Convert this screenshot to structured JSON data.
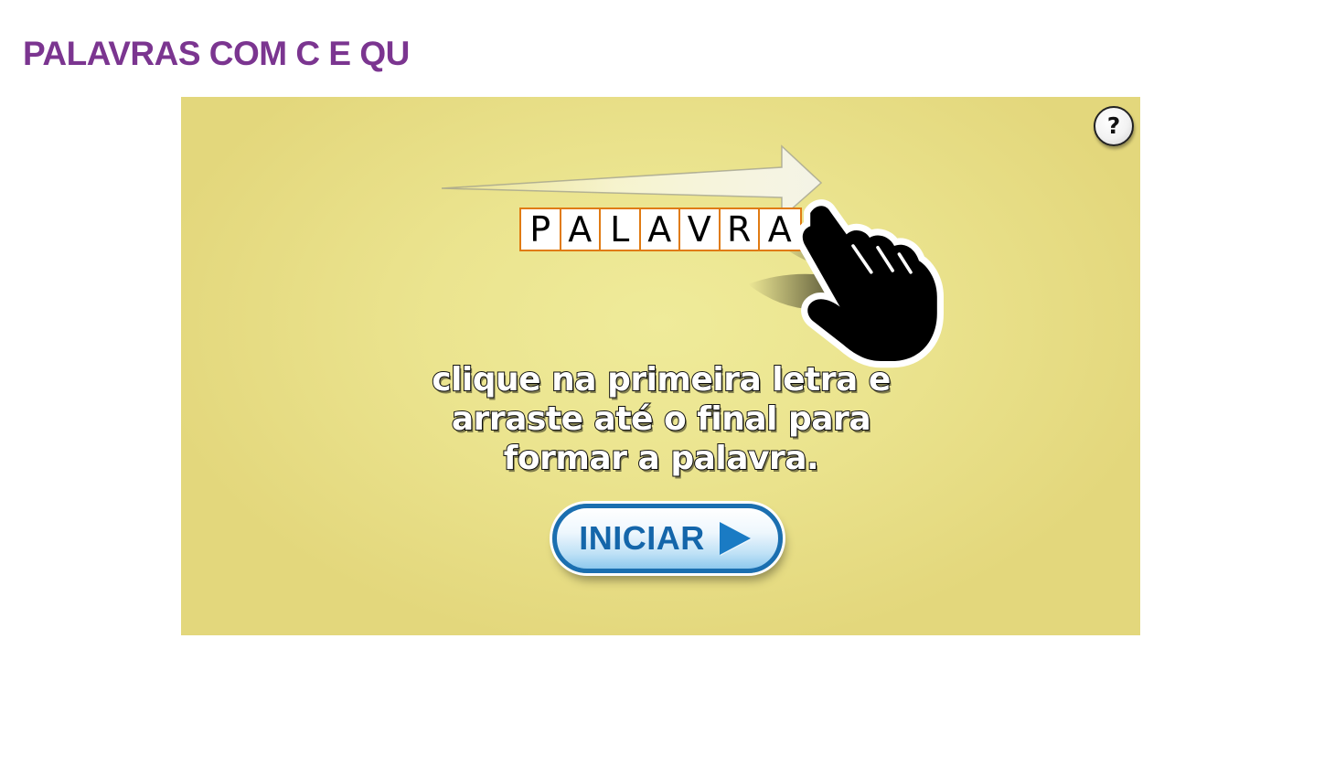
{
  "page": {
    "title": "PALAVRAS COM C E QU"
  },
  "game": {
    "help_label": "?",
    "demo_letters": [
      "P",
      "A",
      "L",
      "A",
      "V",
      "R",
      "A"
    ],
    "instructions": "clique na primeira letra e arraste até o final para formar a palavra.",
    "start_label": "INICIAR"
  },
  "colors": {
    "title": "#7b3590",
    "game_background": "#ebe48f",
    "tile_border": "#e07b12",
    "button_blue": "#1466aa"
  },
  "icons": {
    "help": "question-mark-icon",
    "arrow": "right-arrow-icon",
    "hand": "pointing-hand-icon",
    "play": "play-triangle-icon"
  }
}
